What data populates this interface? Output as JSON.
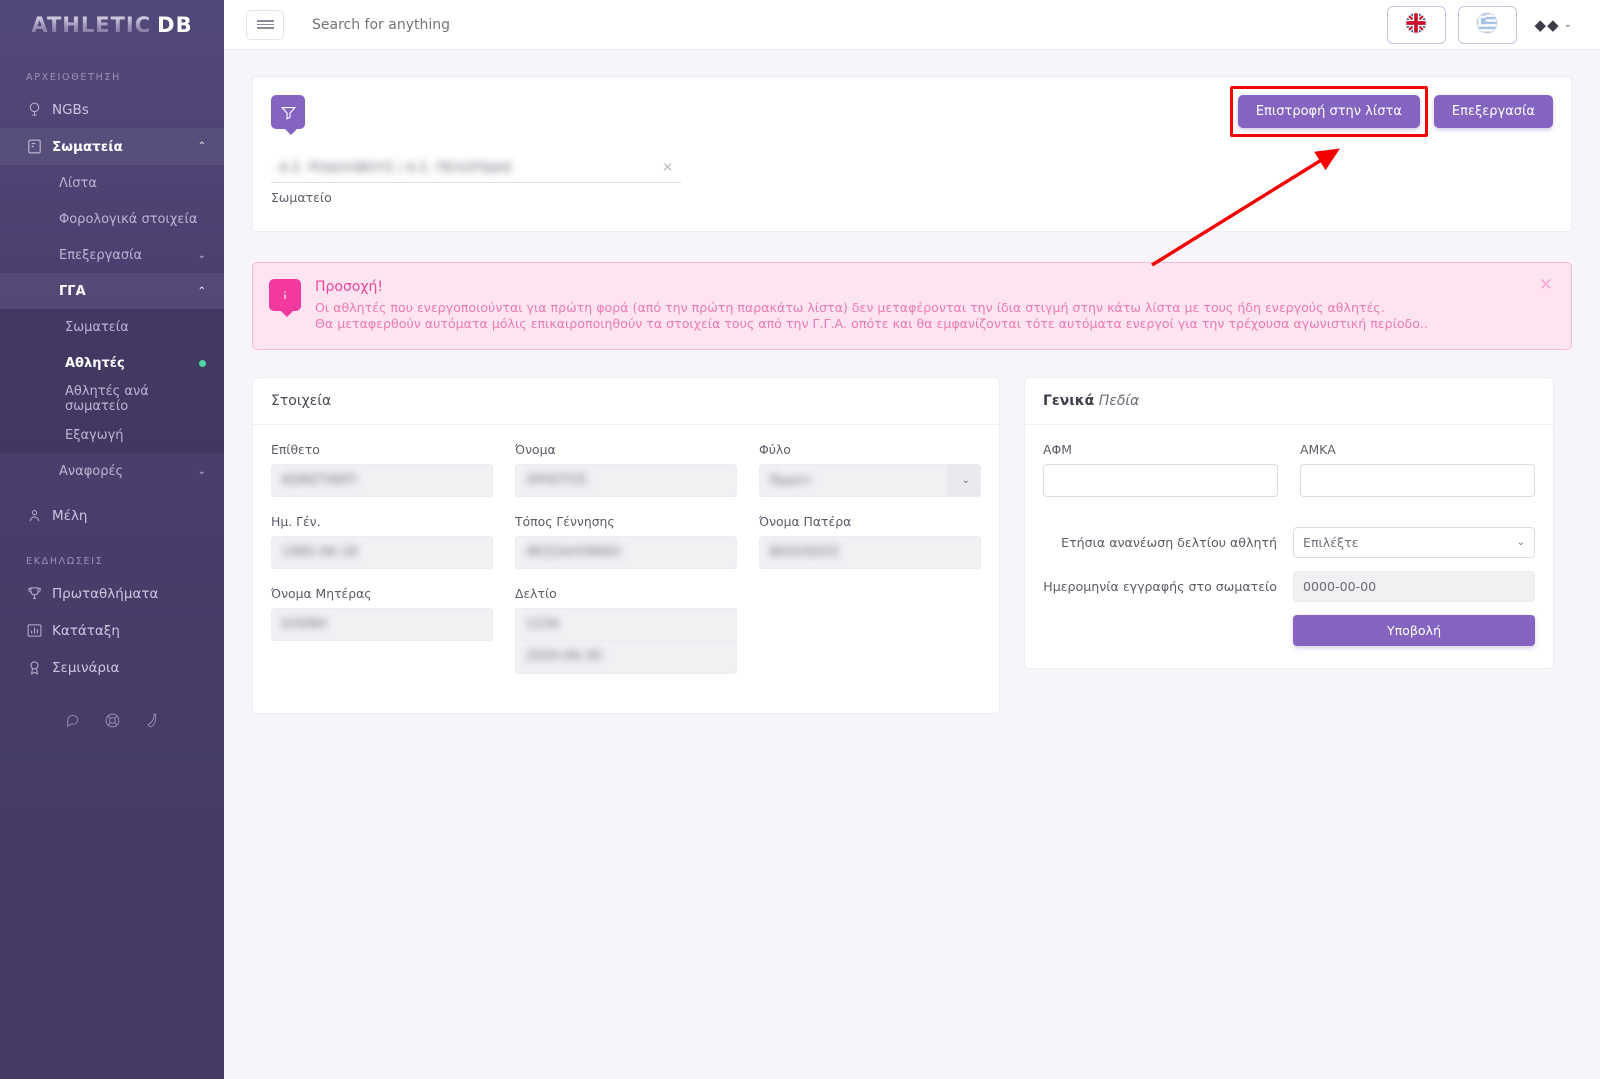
{
  "brand": {
    "part1": "ATHLETIC",
    "part2": "DB"
  },
  "sidebar": {
    "section_archive": "ΑΡΧΕΙΟΘΕΤΗΣΗ",
    "section_events": "ΕΚΔΗΛΩΣΕΙΣ",
    "items": [
      {
        "label": "NGBs",
        "icon": "globe-icon"
      },
      {
        "label": "Σωματεία",
        "icon": "glove-icon",
        "chevron": "⌃"
      }
    ],
    "sub_somateia": [
      {
        "label": "Λίστα"
      },
      {
        "label": "Φορολογικά στοιχεία"
      },
      {
        "label": "Επεξεργασία",
        "chevron": "⌄"
      },
      {
        "label": "ΓΓΑ",
        "chevron": "⌃"
      }
    ],
    "sub_gga": [
      {
        "label": "Σωματεία"
      },
      {
        "label": "Αθλητές",
        "active": true
      },
      {
        "label": "Αθλητές ανά σωματείο"
      },
      {
        "label": "Εξαγωγή"
      }
    ],
    "anafores": {
      "label": "Αναφορές",
      "chevron": "⌄"
    },
    "meli": {
      "label": "Μέλη",
      "icon": "member-icon"
    },
    "events": [
      {
        "label": "Πρωταθλήματα",
        "icon": "trophy-icon"
      },
      {
        "label": "Κατάταξη",
        "icon": "bar-chart-icon"
      },
      {
        "label": "Σεμινάρια",
        "icon": "award-icon"
      }
    ],
    "footer_icons": [
      "chat-icon",
      "lifebuoy-icon",
      "phone-icon"
    ]
  },
  "topbar": {
    "search_placeholder": "Search for anything",
    "lang_en": "gb-flag-icon",
    "lang_gr": "gr-flag-icon",
    "user_glyphs": "◆◆",
    "user_chevron": "⌄"
  },
  "filter": {
    "funnel_icon": "filter-icon",
    "select_value": "Α.Σ. ΡΟΔΟΛΙΒΟΥΣ / Α.Σ. ΠΕΛΟΠΙΔΑΣ",
    "select_clear": "×",
    "select_label": "Σωματείο",
    "back_button": "Επιστροφή στην λίστα",
    "edit_button": "Επεξεργασία"
  },
  "alert": {
    "icon": "info-icon",
    "title": "Προσοχή!",
    "line1": "Οι αθλητές που ενεργοποιούνται για πρώτη φορά (από την πρώτη παρακάτω λίστα) δεν μεταφέρονται την ίδια στιγμή στην κάτω λίστα με τους ήδη ενεργούς αθλητές.",
    "line2": "Θα μεταφερθούν αυτόματα μόλις επικαιροποιηθούν τα στοιχεία τους από την Γ.Γ.Α. οπότε και θα εμφανίζονται τότε αυτόματα ενεργοί για την τρέχουσα αγωνιστική περίοδο..",
    "close": "✕"
  },
  "details_card": {
    "title": "Στοιχεία",
    "fields": [
      {
        "label": "Επίθετο",
        "value": "ΚΩΝΣΤΑΝΤΙ",
        "blurred": true
      },
      {
        "label": "Όνομα",
        "value": "ΧΡΗΣΤΟΣ",
        "blurred": true
      },
      {
        "label": "Φύλο",
        "value": "Άρρεν",
        "blurred": true,
        "type": "select"
      },
      {
        "label": "Ημ. Γέν.",
        "value": "1985-06-18",
        "blurred": true
      },
      {
        "label": "Τόπος Γέννησης",
        "value": "ΘΕΣΣΑΛΟΝΙΚΗ",
        "blurred": true
      },
      {
        "label": "Όνομα Πατέρα",
        "value": "ΒΑΣΙΛΕΙΟΣ",
        "blurred": true
      },
      {
        "label": "Όνομα Μητέρας",
        "value": "ΕΛΕΝΗ",
        "blurred": true
      },
      {
        "label": "Δελτίο",
        "value": "1234",
        "blurred": true,
        "value2": "2020-06-30"
      }
    ]
  },
  "general_card": {
    "title_bold": "Γενικά",
    "title_italic": "Πεδία",
    "afm_label": "ΑΦΜ",
    "afm_value": "",
    "amka_label": "ΑΜΚΑ",
    "amka_value": "",
    "renewal_label": "Ετήσια ανανέωση δελτίου αθλητή",
    "renewal_value": "Επιλέξτε",
    "renewal_chevron": "⌄",
    "regdate_label": "Ημερομηνία εγγραφής στο σωματείο",
    "regdate_value": "0000-00-00",
    "submit_label": "Υποβολή"
  },
  "colors": {
    "sidebar": "#4b4070",
    "accent": "#8464c0",
    "alert_bg": "#fde4f0",
    "alert_accent": "#f2399d",
    "annotation": "#f50000",
    "badge_green": "#4cd6a1"
  }
}
